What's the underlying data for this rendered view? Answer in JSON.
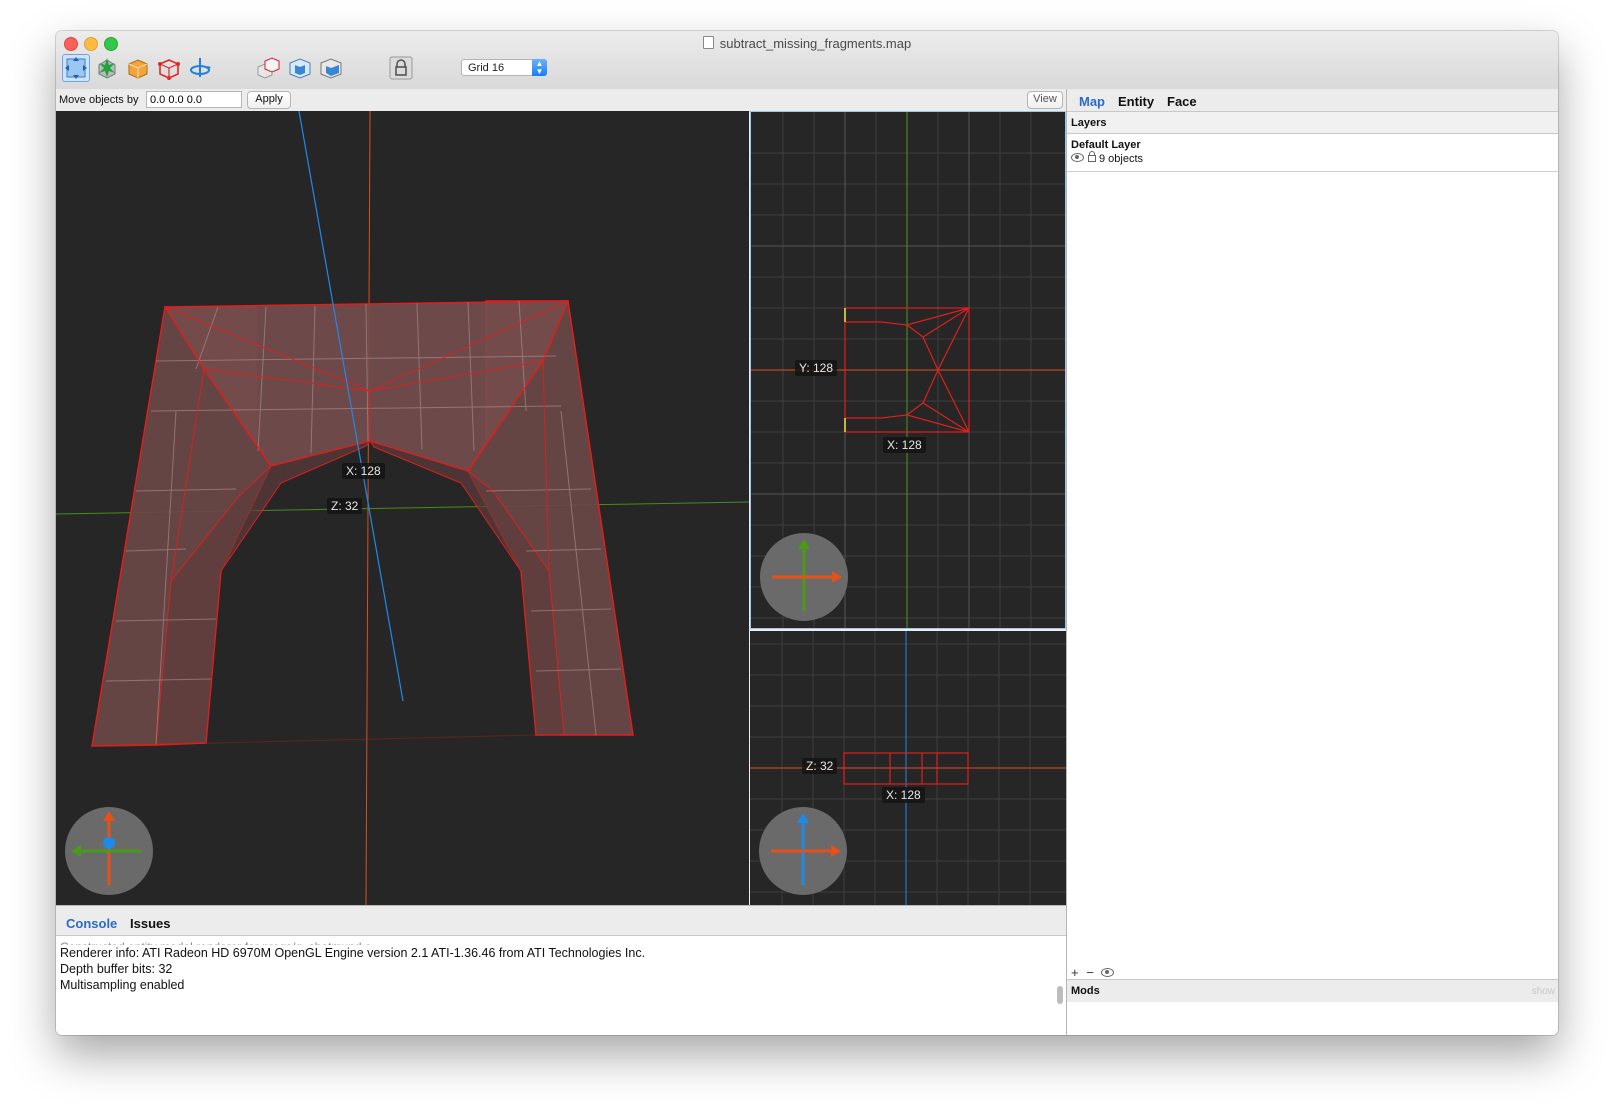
{
  "window": {
    "title": "subtract_missing_fragments.map"
  },
  "toolbar": {
    "tools": [
      {
        "name": "move-tool-icon",
        "active": true
      },
      {
        "name": "vertex-tool-icon",
        "active": false
      },
      {
        "name": "brush-tool-icon",
        "active": false
      },
      {
        "name": "edge-tool-icon",
        "active": false
      },
      {
        "name": "rotate-tool-icon",
        "active": false
      },
      {
        "name": "csg-subtract-icon",
        "active": false
      },
      {
        "name": "csg-merge-icon",
        "active": false
      },
      {
        "name": "csg-intersect-icon",
        "active": false
      },
      {
        "name": "lock-icon",
        "active": false
      }
    ],
    "grid_label": "Grid 16"
  },
  "move_bar": {
    "label": "Move objects by",
    "value": "0.0 0.0 0.0",
    "apply_label": "Apply",
    "view_label": "View"
  },
  "viewports": {
    "perspective": {
      "x_label": "X: 128",
      "z_label": "Z: 32"
    },
    "top": {
      "y_label": "Y: 128",
      "x_label": "X: 128"
    },
    "front": {
      "z_label": "Z: 32",
      "x_label": "X: 128"
    }
  },
  "console": {
    "tabs": [
      "Console",
      "Issues"
    ],
    "active_tab": "Console",
    "cut_line": "Constructed entity model renderer for progs/g_shotmund.c",
    "lines": [
      "Renderer info: ATI Radeon HD 6970M OpenGL Engine version 2.1 ATI-1.36.46 from ATI Technologies Inc.",
      "Depth buffer bits: 32",
      "Multisampling enabled"
    ]
  },
  "inspector": {
    "tabs": [
      "Map",
      "Entity",
      "Face"
    ],
    "active_tab": "Map",
    "layers_header": "Layers",
    "layer": {
      "name": "Default Layer",
      "count": "9 objects"
    },
    "layer_tools": [
      "+",
      "−"
    ],
    "mods_label": "Mods",
    "mods_show": "show"
  },
  "colors": {
    "accent": "#2a6bc9",
    "viewport_bg": "#262626",
    "brush_outline": "#e01e1e",
    "axis_x": "#e8501a",
    "axis_y": "#4a9a1a",
    "axis_z": "#1e8ae8"
  }
}
